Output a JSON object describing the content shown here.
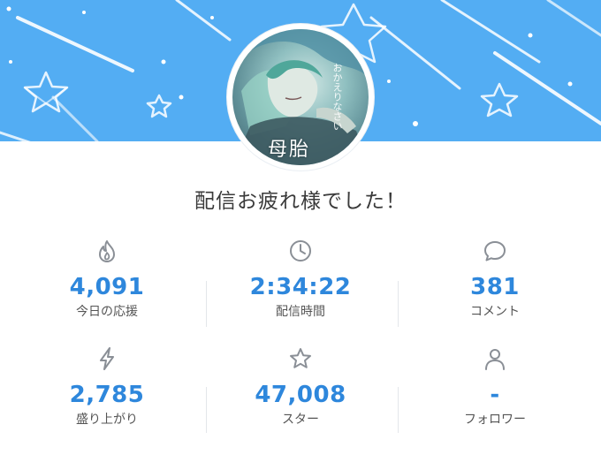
{
  "banner": {
    "color": "#53adf3"
  },
  "profile": {
    "avatar_title": "母胎",
    "avatar_subtitle": "おかえりなさい"
  },
  "headline": "配信お疲れ様でした！",
  "stats": [
    {
      "icon": "flame-icon",
      "value": "4,091",
      "label": "今日の応援"
    },
    {
      "icon": "clock-icon",
      "value": "2:34:22",
      "label": "配信時間"
    },
    {
      "icon": "comment-icon",
      "value": "381",
      "label": "コメント"
    },
    {
      "icon": "lightning-icon",
      "value": "2,785",
      "label": "盛り上がり"
    },
    {
      "icon": "star-icon",
      "value": "47,008",
      "label": "スター"
    },
    {
      "icon": "person-icon",
      "value": "-",
      "label": "フォロワー"
    }
  ],
  "colors": {
    "accent": "#2e87dc",
    "icon": "#8a8f96",
    "text": "#3a3a3a"
  }
}
